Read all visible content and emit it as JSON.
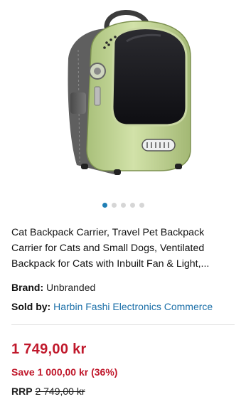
{
  "product": {
    "title": "Cat Backpack Carrier, Travel Pet Backpack Carrier for Cats and Small Dogs, Ventilated Backpack for Cats with Inbuilt Fan & Light,...",
    "image_alt": "green cat backpack carrier with transparent bubble window",
    "brand_label": "Brand:",
    "brand_value": "Unbranded",
    "seller_label": "Sold by:",
    "seller_value": "Harbin Fashi Electronics Commerce"
  },
  "gallery": {
    "count": 5,
    "active_index": 0,
    "active_color": "#1f7fb5"
  },
  "pricing": {
    "price": "1 749,00 kr",
    "save": "Save 1 000,00 kr (36%)",
    "rrp_label": "RRP",
    "rrp_value": "2 749,00 kr",
    "accent_color": "#c0182b"
  }
}
